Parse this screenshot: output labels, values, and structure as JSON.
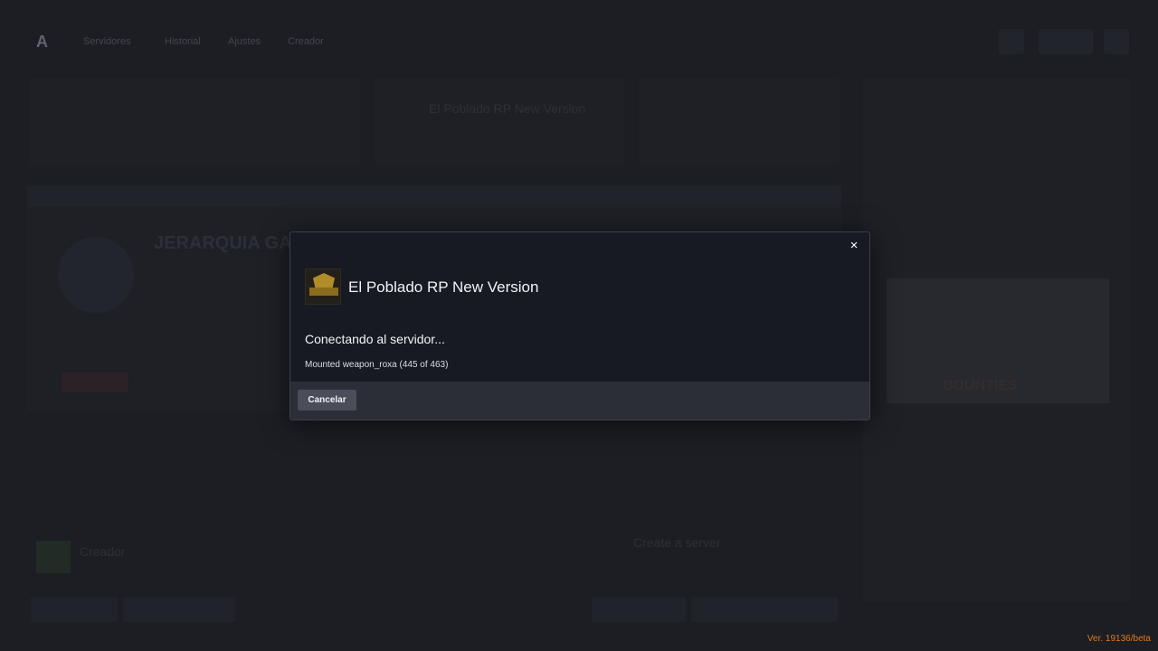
{
  "background": {
    "logo": "A",
    "nav": [
      "Servidores",
      "Historial",
      "Ajustes",
      "Creador"
    ],
    "featured_server_name": "El Poblado RP New Version",
    "server_banner_title": "JERARQUIA GAY",
    "feed_image_title": "BOUNTIES",
    "server_list_left": "Creador",
    "create_server_title": "Create a server"
  },
  "modal": {
    "close_label": "×",
    "server_name": "El Poblado RP New Version",
    "status_text": "Conectando al servidor...",
    "detail_text": "Mounted weapon_roxa (445 of 463)",
    "cancel_label": "Cancelar"
  },
  "version_label": "Ver. 19136/beta",
  "colors": {
    "accent_version": "#e07a1f",
    "modal_bg": "#171a22",
    "modal_footer": "#2b2e36",
    "cancel_button": "#4a4e58"
  }
}
